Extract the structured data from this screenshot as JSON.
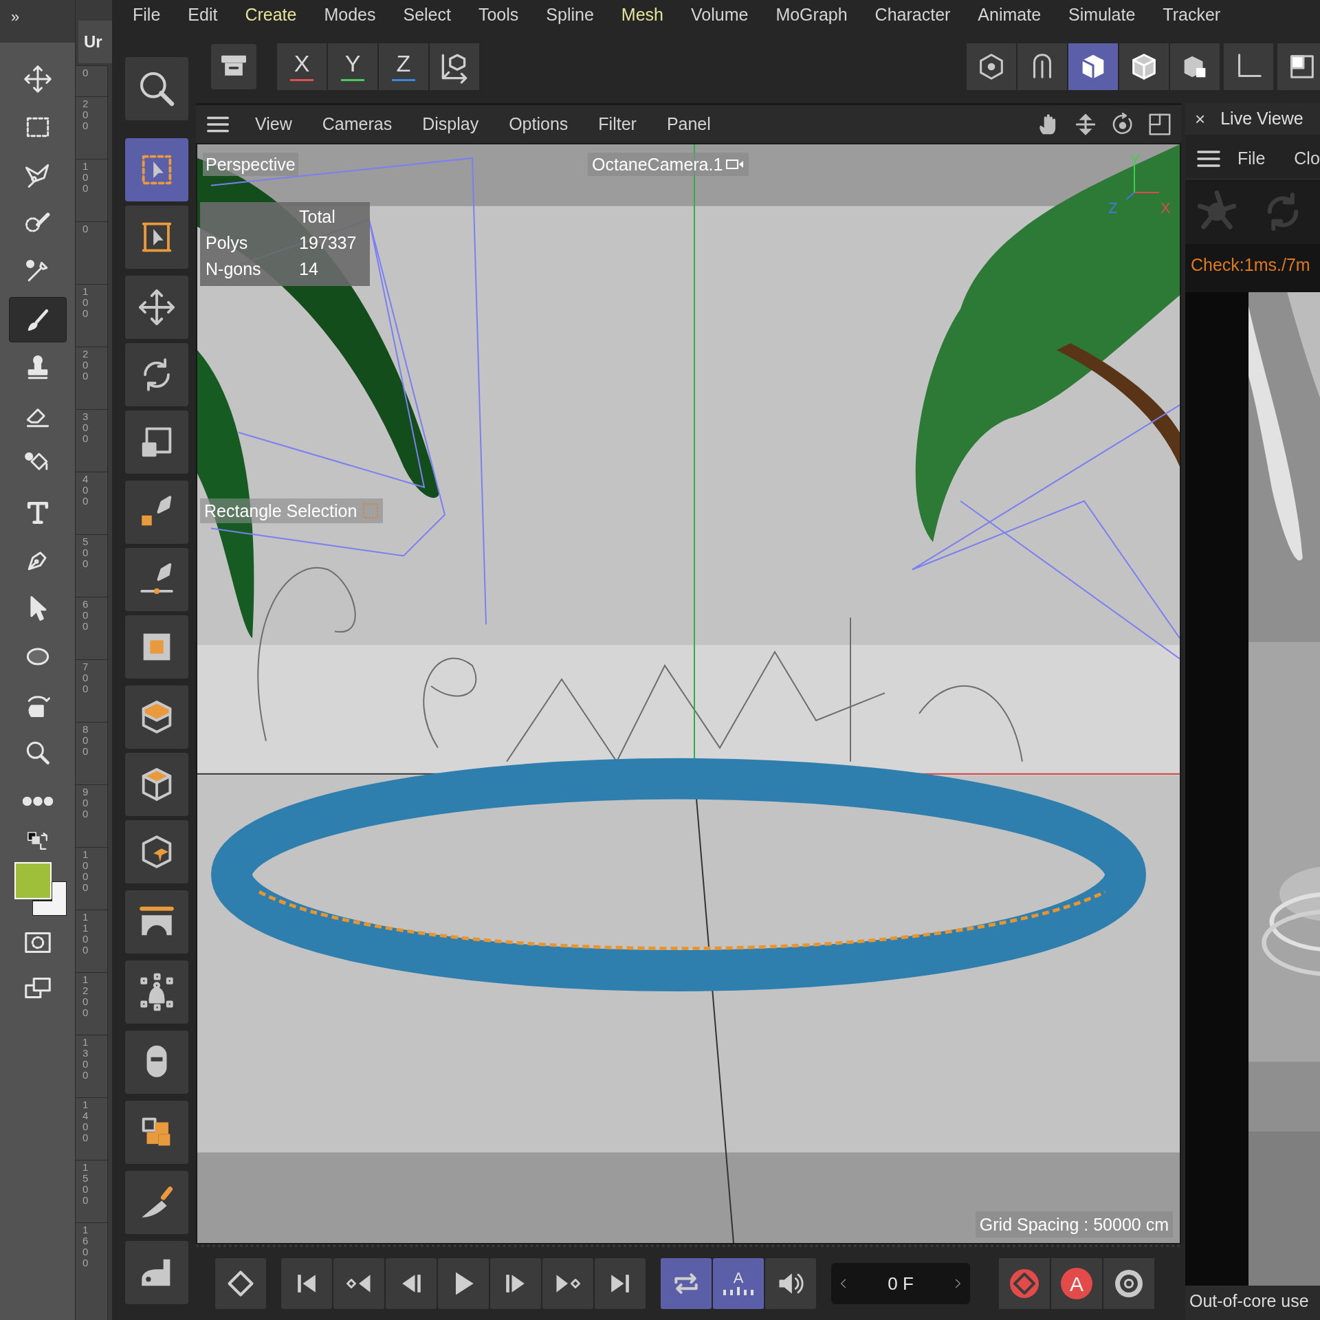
{
  "photoshop": {
    "expand": "»",
    "tab": "Ur",
    "tools": [
      {
        "selected": false
      },
      {
        "selected": false
      },
      {
        "selected": false
      },
      {
        "selected": false
      },
      {
        "selected": false
      },
      {
        "selected": true
      },
      {
        "selected": false
      },
      {
        "selected": false
      },
      {
        "selected": false
      },
      {
        "selected": false
      },
      {
        "selected": false
      },
      {
        "selected": false
      },
      {
        "selected": false
      },
      {
        "selected": false
      },
      {
        "selected": false
      },
      {
        "selected": false
      }
    ],
    "color_swatches": [
      {
        "color": "#9fbf3a"
      },
      {
        "color": "#f4f4f4"
      }
    ],
    "ruler": [
      "0",
      "200",
      "100",
      "0",
      "100",
      "200",
      "300",
      "400",
      "500",
      "600",
      "700",
      "800",
      "900",
      "1000",
      "1100",
      "1200",
      "1300",
      "1400",
      "1500",
      "1600"
    ]
  },
  "menu": [
    {
      "label": "File",
      "highlighted": false
    },
    {
      "label": "Edit",
      "highlighted": false
    },
    {
      "label": "Create",
      "highlighted": true
    },
    {
      "label": "Modes",
      "highlighted": false
    },
    {
      "label": "Select",
      "highlighted": false
    },
    {
      "label": "Tools",
      "highlighted": false
    },
    {
      "label": "Spline",
      "highlighted": false
    },
    {
      "label": "Mesh",
      "highlighted": true
    },
    {
      "label": "Volume",
      "highlighted": false
    },
    {
      "label": "MoGraph",
      "highlighted": false
    },
    {
      "label": "Character",
      "highlighted": false
    },
    {
      "label": "Animate",
      "highlighted": false
    },
    {
      "label": "Simulate",
      "highlighted": false
    },
    {
      "label": "Tracker",
      "highlighted": false
    }
  ],
  "toolbar": {
    "axes": [
      {
        "label": "X",
        "color": "#e05252"
      },
      {
        "label": "Y",
        "color": "#4cc95a"
      },
      {
        "label": "Z",
        "color": "#3a86d8"
      }
    ],
    "modes": [
      {
        "selected": false
      },
      {
        "selected": false
      },
      {
        "selected": true
      },
      {
        "selected": false
      },
      {
        "selected": false
      },
      {
        "selected": false
      },
      {
        "selected": false
      }
    ]
  },
  "palette": [
    [
      {
        "selected": true
      },
      {
        "selected": false
      }
    ],
    [
      {
        "selected": false
      },
      {
        "selected": false
      },
      {
        "selected": false
      }
    ],
    [
      {
        "selected": false
      },
      {
        "selected": false
      },
      {
        "selected": false
      }
    ],
    [
      {
        "selected": false
      },
      {
        "selected": false
      },
      {
        "selected": false
      }
    ],
    [
      {
        "selected": false
      }
    ],
    [
      {
        "selected": false
      }
    ],
    [
      {
        "selected": false
      }
    ],
    [
      {
        "selected": false
      }
    ],
    [
      {
        "selected": false
      }
    ],
    [
      {
        "selected": false
      }
    ]
  ],
  "viewport": {
    "menu": [
      "View",
      "Cameras",
      "Display",
      "Options",
      "Filter",
      "Panel"
    ],
    "camera_label": "Perspective",
    "camera_name": "OctaneCamera.1",
    "stats": {
      "header": "Total",
      "rows": [
        {
          "label": "Polys",
          "value": "197337"
        },
        {
          "label": "N-gons",
          "value": "14"
        }
      ]
    },
    "axis_labels": [
      "Y",
      "Z",
      "X"
    ],
    "tool_label": "Rectangle Selection",
    "grid_spacing": "Grid Spacing : 50000 cm"
  },
  "timeline": {
    "groups": [
      [
        {
          "selected": false
        }
      ],
      [
        {
          "selected": false
        },
        {
          "selected": false
        },
        {
          "selected": false
        },
        {
          "selected": false
        },
        {
          "selected": false
        },
        {
          "selected": false
        },
        {
          "selected": false
        }
      ],
      [
        {
          "selected": true
        },
        {
          "glyph": "A",
          "selected": true
        },
        {
          "selected": false
        }
      ]
    ],
    "frame": "0 F",
    "record": [
      {
        "selected": false
      },
      {
        "glyph": "A",
        "selected": false
      },
      {
        "selected": false
      }
    ]
  },
  "live_viewer": {
    "close": "×",
    "title": "Live Viewe",
    "menu": [
      "File",
      "Clo"
    ],
    "status": "Check:1ms./7m",
    "footer": "Out-of-core use"
  }
}
